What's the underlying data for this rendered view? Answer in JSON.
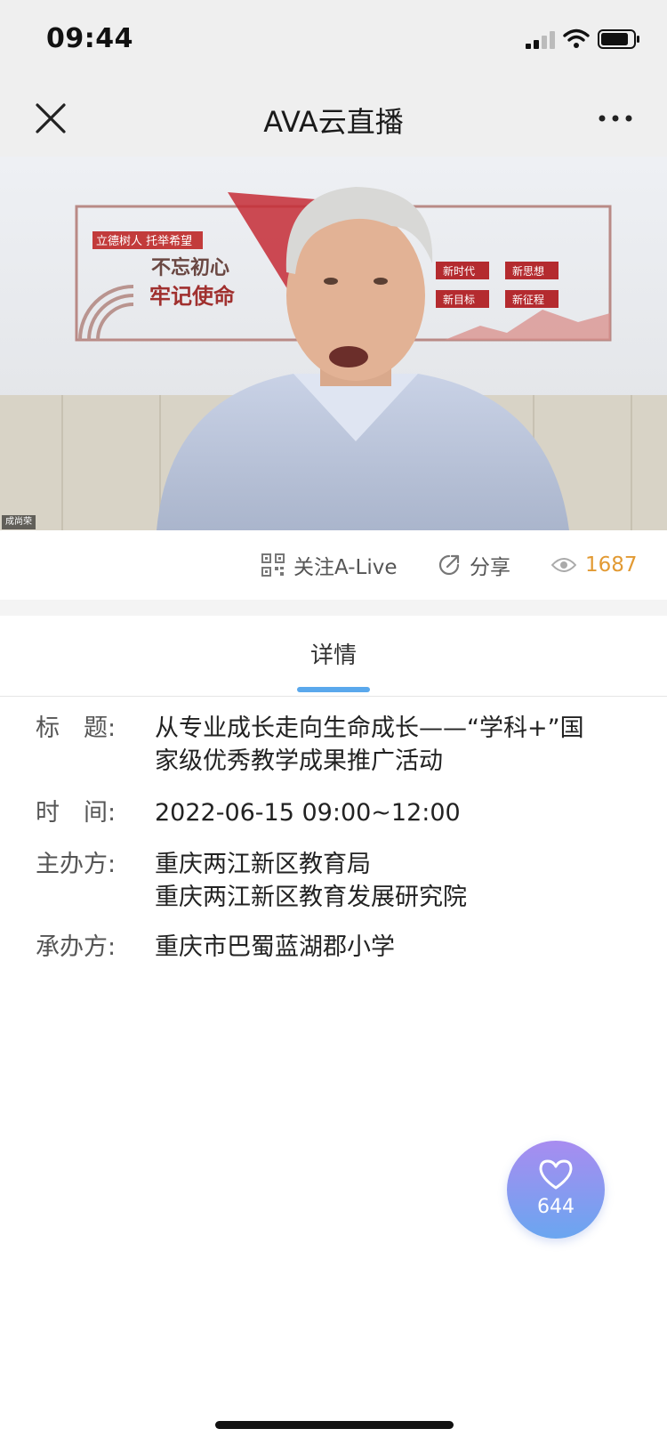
{
  "status_bar": {
    "time": "09:44",
    "icons": [
      "signal-icon",
      "wifi-icon",
      "battery-icon"
    ]
  },
  "nav": {
    "title": "AVA云直播",
    "icons": [
      "close-icon",
      "more-icon"
    ]
  },
  "video": {
    "speaker_name": "成尚荣",
    "backdrop_texts": [
      "立德树人 托举希望",
      "不忘初心",
      "牢记使命",
      "新时代",
      "新思想",
      "新目标",
      "新征程"
    ]
  },
  "actions": {
    "follow_label": "关注A-Live",
    "share_label": "分享",
    "view_count": "1687",
    "icons": [
      "qr-code-icon",
      "share-icon",
      "eye-icon"
    ]
  },
  "tabs": [
    {
      "label": "详情",
      "active": true
    }
  ],
  "details": [
    {
      "label": "标　题:",
      "lines": [
        "从专业成长走向生命成长——“学科+”国",
        "家级优秀教学成果推广活动"
      ]
    },
    {
      "label": "时　间:",
      "lines": [
        "2022-06-15 09:00~12:00"
      ]
    },
    {
      "label": "主办方:",
      "lines": [
        "重庆两江新区教育局",
        "重庆两江新区教育发展研究院"
      ]
    },
    {
      "label": "承办方:",
      "lines": [
        "重庆市巴蜀蓝湖郡小学"
      ]
    }
  ],
  "like": {
    "count": "644",
    "icon": "heart-icon"
  },
  "colors": {
    "accent_tab": "#5aa8ec",
    "view_count": "#e29a33",
    "like_gradient_top": "#a88cf0",
    "like_gradient_bottom": "#6aa6f0",
    "bar_background": "#efefef"
  }
}
